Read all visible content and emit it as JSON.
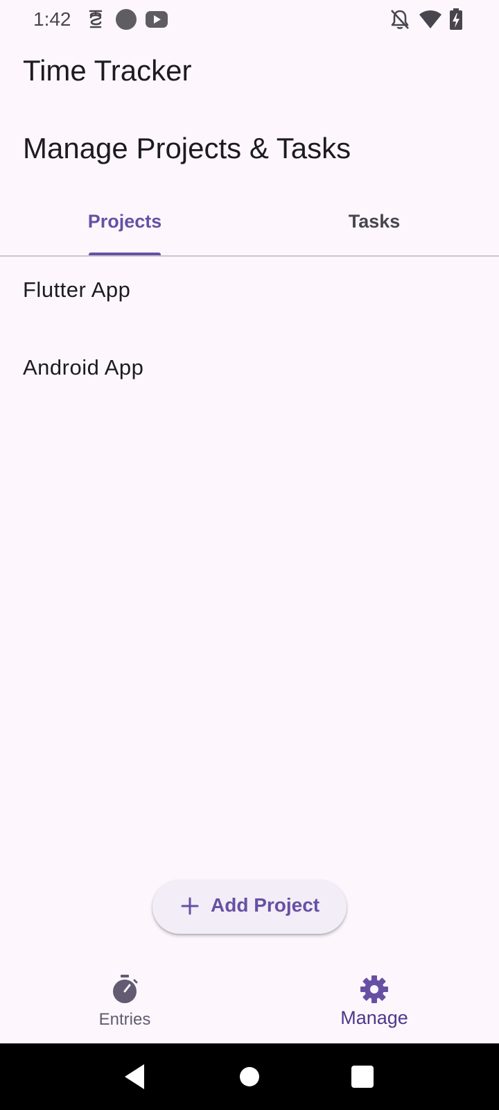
{
  "status_bar": {
    "time": "1:42",
    "left_icons": [
      "vpn-key-icon",
      "circle-icon",
      "youtube-icon"
    ],
    "right_icons": [
      "notifications-off-icon",
      "wifi-icon",
      "battery-charging-icon"
    ]
  },
  "app_bar": {
    "title": "Time Tracker"
  },
  "page": {
    "title": "Manage Projects & Tasks"
  },
  "tabs": [
    {
      "label": "Projects",
      "active": true
    },
    {
      "label": "Tasks",
      "active": false
    }
  ],
  "projects": [
    {
      "name": "Flutter App"
    },
    {
      "name": "Android App"
    }
  ],
  "fab": {
    "icon": "plus-icon",
    "label": "Add Project"
  },
  "bottom_nav": [
    {
      "label": "Entries",
      "icon": "timer-icon",
      "active": false
    },
    {
      "label": "Manage",
      "icon": "gear-icon",
      "active": true
    }
  ],
  "system_nav": [
    "back-icon",
    "home-icon",
    "recents-icon"
  ],
  "colors": {
    "primary": "#6750a4",
    "background": "#fdf7fd",
    "on_surface": "#1d1b20",
    "on_surface_variant": "#49454f",
    "fab_container": "#f3edf7"
  }
}
